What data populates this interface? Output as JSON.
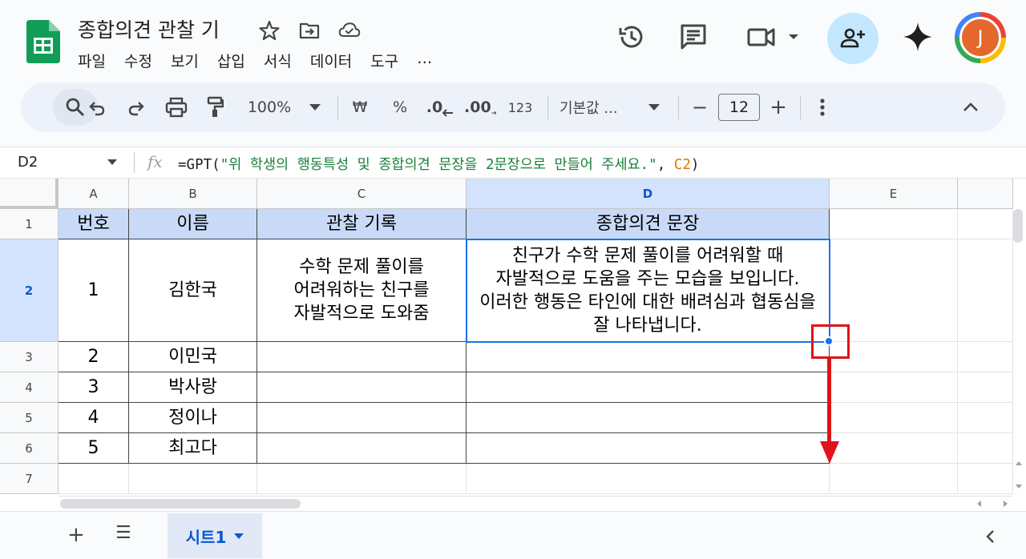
{
  "app": {
    "title": "종합의견 관찰 기",
    "avatar_letter": "J",
    "brand_color": "#0f9d58",
    "accent_color": "#1a73e8"
  },
  "menu": [
    "파일",
    "수정",
    "보기",
    "삽입",
    "서식",
    "데이터",
    "도구",
    "…"
  ],
  "title_icons": [
    "star-icon",
    "move-to-folder-icon",
    "cloud-saved-icon"
  ],
  "header_icons": [
    "version-history-icon",
    "comments-icon",
    "meet-video-icon",
    "share-add-person-icon",
    "gemini-sparkle-icon"
  ],
  "toolbar": {
    "zoom": "100%",
    "currency": "₩",
    "percent": "%",
    "dec_decrease": ".0",
    "dec_increase": ".00",
    "number_format": "123",
    "font_name": "기본값 ...",
    "font_size": "12",
    "minus": "−",
    "plus": "+"
  },
  "formula_bar": {
    "cell_ref": "D2",
    "fx": "fx",
    "prefix": "=GPT(",
    "string_arg": "\"위 학생의 행동특성 및 종합의견 문장을 2문장으로 만들어 주세요.\"",
    "sep": ", ",
    "ref_arg": "C2",
    "suffix": ")"
  },
  "columns": [
    "A",
    "B",
    "C",
    "D",
    "E"
  ],
  "rows": [
    "1",
    "2",
    "3",
    "4",
    "5",
    "6",
    "7"
  ],
  "table": {
    "headers": [
      "번호",
      "이름",
      "관찰 기록",
      "종합의견 문장"
    ],
    "data": [
      [
        "1",
        "김한국",
        "수학 문제 풀이를 어려워하는 친구를 자발적으로 도와줌",
        "친구가 수학 문제 풀이를 어려워할 때 자발적으로 도움을 주는 모습을 보입니다. 이러한 행동은 타인에 대한 배려심과 협동심을 잘 나타냅니다."
      ],
      [
        "2",
        "이민국",
        "",
        ""
      ],
      [
        "3",
        "박사랑",
        "",
        ""
      ],
      [
        "4",
        "정이나",
        "",
        ""
      ],
      [
        "5",
        "최고다",
        "",
        ""
      ]
    ]
  },
  "sheets": {
    "active": "시트1",
    "add": "+",
    "list": "☰"
  }
}
